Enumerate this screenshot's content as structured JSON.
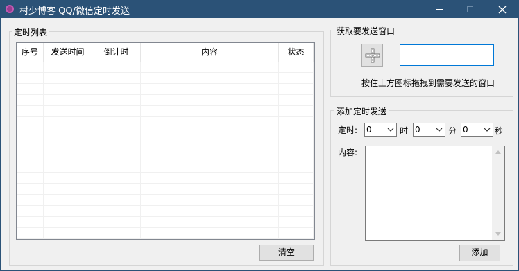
{
  "window": {
    "title": "村少博客 QQ/微信定时发送",
    "minimize_label": "—",
    "close_label": "✕"
  },
  "schedule_group": {
    "title": "定时列表",
    "columns": [
      "序号",
      "发送时间",
      "倒计时",
      "内容",
      "状态"
    ],
    "rows": [],
    "clear_button": "清空"
  },
  "target_group": {
    "title": "获取要发送窗口",
    "hint": "按住上方图标拖拽到需要发送的窗口",
    "window_field_value": ""
  },
  "add_group": {
    "title": "添加定时发送",
    "timer_label": "定时:",
    "hour_value": "0",
    "hour_unit": "时",
    "minute_value": "0",
    "minute_unit": "分",
    "second_value": "0",
    "second_unit": "秒",
    "content_label": "内容:",
    "content_value": "",
    "add_button": "添加"
  }
}
